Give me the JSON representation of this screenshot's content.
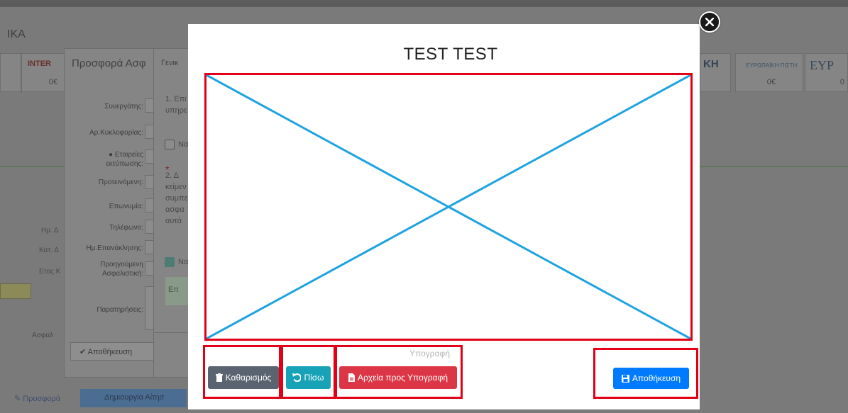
{
  "background": {
    "header_title": "ΙΚΑ",
    "insurers": [
      {
        "name": "INTER",
        "value": "0€"
      },
      {
        "name": "ΚΗ",
        "value": ""
      },
      {
        "name": "ΕΥΡΩΠΑΪΚΗ ΠΙΣΤΗ",
        "value": "0€"
      },
      {
        "name": "ΕΥΡ",
        "value": "0"
      }
    ],
    "left_labels": [
      "Ημ. Δ",
      "Κατ. Δ",
      "Ετος Κ",
      "Ασφαλ"
    ],
    "bottom_link": "Προσφορά",
    "bottom_button": "Δημιουργία Αίτησ",
    "offer_panel": {
      "title": "Προσφορά Ασφ",
      "fields": [
        "Συνεργάτης:",
        "Αρ.Κυκλοφορίας:",
        "Εταιρείες εκτύπωσης:",
        "Προτεινόμενη:",
        "Επωνυμία:",
        "Τηλέφωνο:",
        "Ημ.Επανάκλησης:",
        "Προηγούμενη Ασφαλιστική:",
        "Παρατηρήσεις:"
      ],
      "save_label": "Αποθήκευση"
    },
    "general_panel": {
      "title": "Γενικ",
      "item1_lines": [
        "1. Επι",
        "υπηρε"
      ],
      "check1_label": "Να",
      "item2_lines": [
        "2. Δ",
        "κείμεν",
        "συμπε",
        "ασφα",
        "αυτά"
      ],
      "check2_label": "Να",
      "box_text": "Επ"
    }
  },
  "modal": {
    "title": "TEST TEST",
    "signature_label": "Υπογραφή",
    "buttons": {
      "clear": "Καθαρισμός",
      "back": "Πίσω",
      "files": "Αρχεία προς Υπογραφή",
      "save": "Αποθήκευση"
    }
  },
  "colors": {
    "highlight": "#e30016",
    "signature_stroke": "#1ea3e0",
    "clear_button": "#5a6470",
    "back_button": "#17a2b8",
    "files_button": "#dc3545",
    "save_button": "#007bff"
  }
}
